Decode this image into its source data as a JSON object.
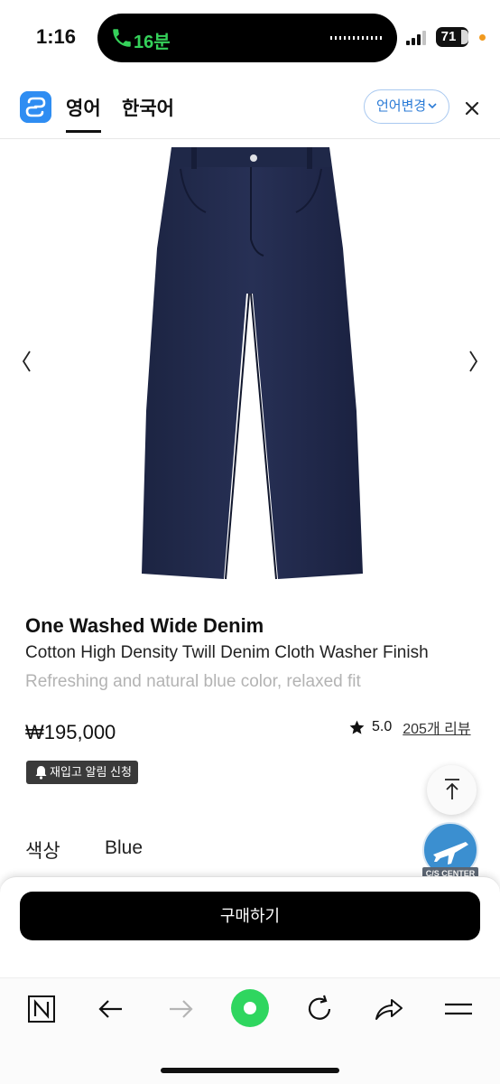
{
  "status_bar": {
    "time": "1:16",
    "call_duration": "16분",
    "battery": "71"
  },
  "translate_bar": {
    "tabs": [
      {
        "label": "영어",
        "active": true
      },
      {
        "label": "한국어",
        "active": false
      }
    ],
    "change_language_label": "언어변경",
    "accent_color": "#2f8df2"
  },
  "product": {
    "title": "One Washed Wide Denim",
    "subtitle": "Cotton High Density Twill Denim Cloth Washer Finish",
    "description": "Refreshing and natural blue color, relaxed fit",
    "price": "₩195,000",
    "rating": "5.0",
    "review_link": "205개 리뷰",
    "restock_label": "재입고 알림 신청",
    "color_label": "색상",
    "color_value": "Blue"
  },
  "cs_badge": {
    "label": "C/S CENTER"
  },
  "buy_button": {
    "label": "구매하기"
  },
  "browser_nav": {
    "items": [
      "n-icon",
      "back-arrow-icon",
      "forward-arrow-icon",
      "green-dot-icon",
      "reload-icon",
      "share-icon",
      "menu-icon"
    ]
  }
}
